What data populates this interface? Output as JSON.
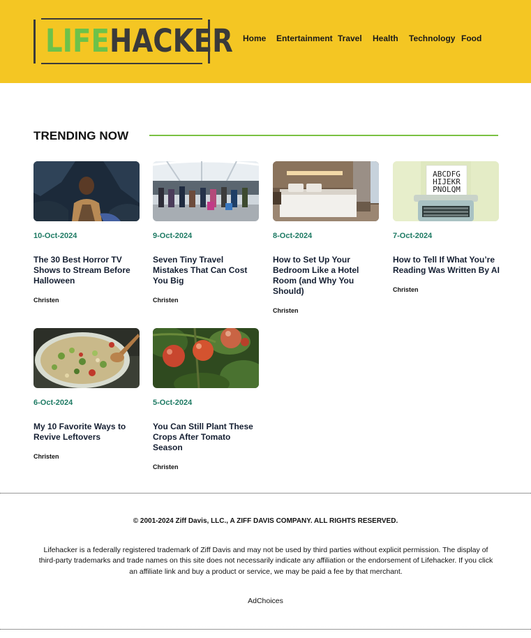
{
  "header": {
    "logo_part1": "LIFE",
    "logo_part2": "HACKER",
    "background": "#f4c623",
    "nav": [
      "Home",
      "Entertainment",
      "Travel",
      "Health",
      "Technology",
      "Food"
    ]
  },
  "trending": {
    "title": "TRENDING NOW",
    "accent": "#7ac143",
    "date_color": "#1d7a63",
    "articles": [
      {
        "image": "horror-movie-thumbnail",
        "date": "10-Oct-2024",
        "title": "The 30 Best Horror TV Shows to Stream Before Halloween",
        "author": "Christen"
      },
      {
        "image": "airport-thumbnail",
        "date": "9-Oct-2024",
        "title": "Seven Tiny Travel Mistakes That Can Cost You Big",
        "author": "Christen"
      },
      {
        "image": "hotel-bedroom-thumbnail",
        "date": "8-Oct-2024",
        "title": "How to Set Up Your Bedroom Like a Hotel Room (and Why You Should)",
        "author": "Christen"
      },
      {
        "image": "typewriter-thumbnail",
        "date": "7-Oct-2024",
        "title": "How to Tell If What You’re Reading Was Written By AI",
        "author": "Christen",
        "typewriter_text": [
          "ABCDFG",
          "HIJEKR",
          "PNOLQM"
        ]
      },
      {
        "image": "leftovers-salad-thumbnail",
        "date": "6-Oct-2024",
        "title": "My 10 Favorite Ways to Revive Leftovers",
        "author": "Christen"
      },
      {
        "image": "tomato-plant-thumbnail",
        "date": "5-Oct-2024",
        "title": "You Can Still Plant These Crops After Tomato Season",
        "author": "Christen"
      }
    ]
  },
  "footer": {
    "copyright": "© 2001-2024 Ziff Davis, LLC., A ZIFF DAVIS COMPANY. ALL RIGHTS RESERVED.",
    "legal": "Lifehacker is a federally registered trademark of Ziff Davis and may not be used by third parties without explicit permission. The display of third-party trademarks and trade names on this site does not necessarily indicate any affiliation or the endorsement of Lifehacker. If you click an affiliate link and buy a product or service, we may be paid a fee by that merchant.",
    "adchoices": "AdChoices"
  }
}
